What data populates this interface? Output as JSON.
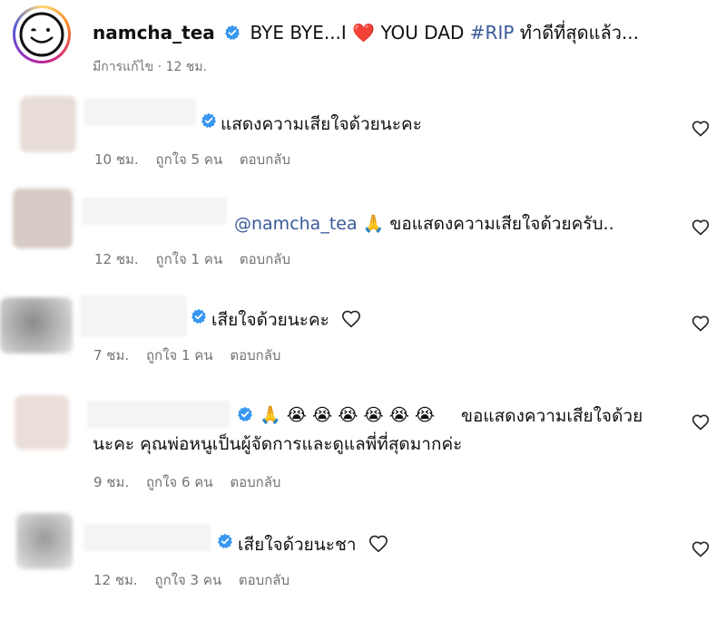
{
  "post": {
    "username": "namcha_tea",
    "caption_pre": "BYE BYE...I",
    "caption_heart": "❤️",
    "caption_mid": "YOU DAD",
    "hashtag": "#RIP",
    "caption_post": "ทำดีที่สุดแล้ว...",
    "edited": "มีการแก้ไข",
    "time": "12 ชม."
  },
  "comments": [
    {
      "text": "แสดงความเสียใจด้วยนะคะ",
      "time": "10 ชม.",
      "likes": "ถูกใจ 5 คน",
      "reply": "ตอบกลับ"
    },
    {
      "mention": "@namcha_tea",
      "emoji": "🙏",
      "text": "ขอแสดงความเสียใจด้วยครับ..",
      "time": "12 ชม.",
      "likes": "ถูกใจ 1 คน",
      "reply": "ตอบกลับ"
    },
    {
      "text": "เสียใจด้วยนะคะ",
      "time": "7 ชม.",
      "likes": "ถูกใจ 1 คน",
      "reply": "ตอบกลับ"
    },
    {
      "emoji_prayer": "🙏",
      "emoji_cry": "😭",
      "text": "ขอแสดงความเสียใจด้วย นะคะ คุณพ่อหนูเป็นผู้จัดการและดูแลพี่ที่สุดมากค่ะ",
      "time": "9 ชม.",
      "likes": "ถูกใจ 6 คน",
      "reply": "ตอบกลับ"
    },
    {
      "text": "เสียใจด้วยนะชา",
      "time": "12 ชม.",
      "likes": "ถูกใจ 3 คน",
      "reply": "ตอบกลับ"
    }
  ],
  "icons": {
    "verified": "verified-badge-icon",
    "heart": "heart-outline-icon"
  },
  "colors": {
    "verified_blue": "#3897f0",
    "muted": "#737373",
    "hashtag": "#3a5a9a",
    "heart_red": "#e0245e"
  }
}
